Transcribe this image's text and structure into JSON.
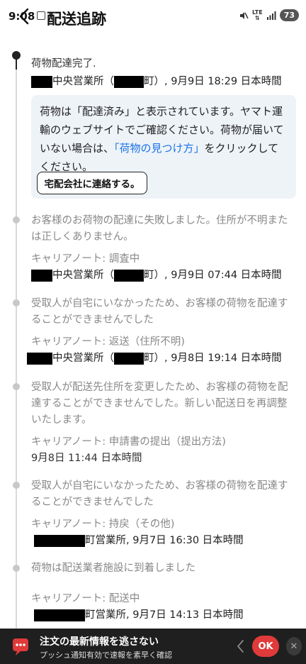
{
  "status_bar": {
    "time": "9:08",
    "network": "LTE",
    "battery": "73"
  },
  "header": {
    "title": "配送追跡"
  },
  "events": [
    {
      "title": "荷物配達完了.",
      "location_suffix": "中央営業所（",
      "location_end": "町）, 9月9日 18:29 日本時間"
    },
    {
      "title": "お客様のお荷物の配達に失敗しました。住所が不明または正しくありません。",
      "note": "キャリアノート: 調査中",
      "location_suffix": "中央営業所（",
      "location_end": "町）, 9月9日 07:44 日本時間"
    },
    {
      "title": "受取人が自宅にいなかったため、お客様の荷物を配達することができませんでした",
      "note": "キャリアノート: 返送（住所不明)",
      "location_suffix": "中央営業所（",
      "location_end": "町）, 9月8日 19:14 日本時間"
    },
    {
      "title": "受取人が配送先住所を変更したため、お客様の荷物を配達することができませんでした。新しい配送日を再調整いたします。",
      "note": "キャリアノート: 申請書の提出（提出方法)",
      "timestamp": "9月8日 11:44 日本時間"
    },
    {
      "title": "受取人が自宅にいなかったため、お客様の荷物を配達することができませんでした",
      "note": "キャリアノート: 持戻（その他)",
      "location_end": "町営業所, 9月7日 16:30 日本時間"
    },
    {
      "title": "荷物は配送業者施設に到着しました",
      "note": "キャリアノート: 配送中",
      "location_end": "町営業所, 9月7日 14:13 日本時間"
    }
  ],
  "info_box": {
    "text_before": "荷物は「配達済み」と表示されています。ヤマト運輸のウェブサイトでご確認ください。荷物が届いていない場合は、",
    "link": "「荷物の見つけ方」",
    "text_after": "をクリックしてください。",
    "button": "宅配会社に連絡する。"
  },
  "bottom_bar": {
    "title": "注文の最新情報を逃さない",
    "subtitle": "プッシュ通知有効で速報を素早く確認",
    "ok_label": "OK",
    "close_label": "✕",
    "accent": "#e03a3a"
  }
}
